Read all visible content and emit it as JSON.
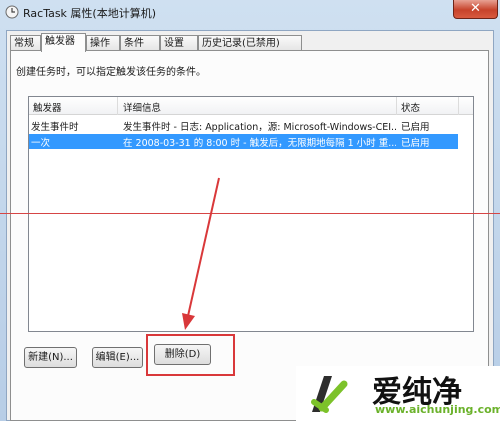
{
  "window": {
    "title": "RacTask 属性(本地计算机)",
    "close_label": "✕"
  },
  "tabs": [
    {
      "label": "常规"
    },
    {
      "label": "触发器",
      "active": true
    },
    {
      "label": "操作"
    },
    {
      "label": "条件"
    },
    {
      "label": "设置"
    },
    {
      "label": "历史记录(已禁用)"
    }
  ],
  "description": "创建任务时，可以指定触发该任务的条件。",
  "table": {
    "columns": [
      "触发器",
      "详细信息",
      "状态"
    ],
    "rows": [
      {
        "trigger": "发生事件时",
        "details": "发生事件时 - 日志: Application，源: Microsoft-Windows-CEI...",
        "status": "已启用",
        "selected": false
      },
      {
        "trigger": "一次",
        "details": "在 2008-03-31 的 8:00 时 - 触发后，无限期地每隔 1 小时 重...",
        "status": "已启用",
        "selected": true
      }
    ]
  },
  "buttons": {
    "new_label": "新建(N)...",
    "edit_label": "编辑(E)...",
    "delete_label": "删除(D)"
  },
  "watermark": {
    "brand": "爱纯净",
    "url": "www.aichunjing.com"
  },
  "colors": {
    "selection": "#3399ff",
    "annotation": "#d9383a"
  }
}
